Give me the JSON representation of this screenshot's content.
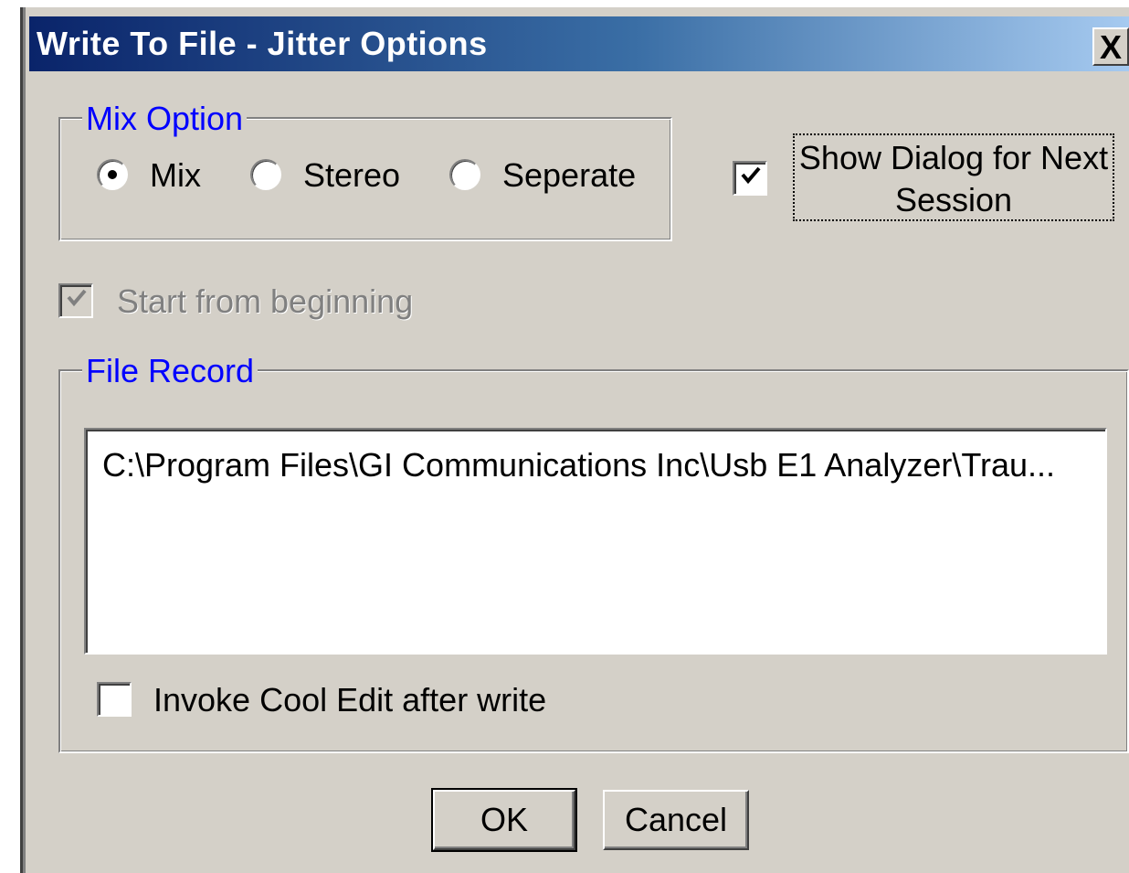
{
  "window": {
    "title": "Write To File - Jitter Options",
    "close_glyph": "X"
  },
  "mix_option": {
    "legend": "Mix Option",
    "options": [
      {
        "label": "Mix",
        "selected": true
      },
      {
        "label": "Stereo",
        "selected": false
      },
      {
        "label": "Seperate",
        "selected": false
      }
    ]
  },
  "show_dialog": {
    "label_line1": "Show Dialog for Next",
    "label_line2": "Session",
    "checked": true
  },
  "start_from_beginning": {
    "label": "Start from beginning",
    "checked": true,
    "enabled": false
  },
  "file_record": {
    "legend": "File Record",
    "items": [
      "C:\\Program Files\\GI Communications Inc\\Usb E1 Analyzer\\Trau..."
    ]
  },
  "invoke_cool_edit": {
    "label": "Invoke Cool Edit after write",
    "checked": false
  },
  "buttons": {
    "ok": "OK",
    "cancel": "Cancel"
  },
  "colors": {
    "dialog_bg": "#d4d0c8",
    "title_gradient_start": "#0a246a",
    "title_gradient_end": "#a6caf0",
    "legend_text": "#0000ff"
  },
  "icons": {
    "close": "close-icon",
    "check": "check-icon"
  }
}
